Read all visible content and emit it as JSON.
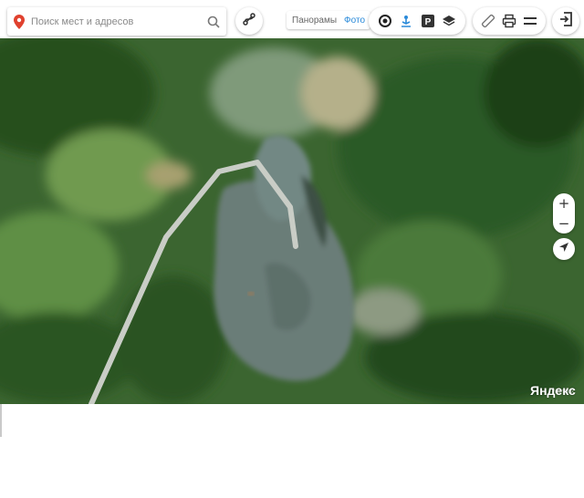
{
  "search": {
    "placeholder": "Поиск мест и адресов"
  },
  "panorama_toggle": {
    "panoramas_label": "Панорамы",
    "photo_label": "Фото"
  },
  "controls": {
    "zoom_in": "+",
    "zoom_out": "−",
    "route_icon": "route-icon",
    "traffic_icon": "traffic-icon",
    "transport_icon": "transport-icon",
    "parking_icon": "parking-icon",
    "layers_icon": "layers-icon",
    "ruler_icon": "ruler-icon",
    "print_icon": "print-icon",
    "menu_icon": "menu-icon",
    "login_icon": "login-icon",
    "geolocation_icon": "geolocation-icon"
  },
  "brand": {
    "logo_text": "Яндекс",
    "watermark": "Yandex"
  },
  "colors": {
    "accent_blue": "#2a8ad9",
    "pin_red": "#e0412e",
    "forest": "#2f5a27",
    "quarry": "#6a7d78"
  }
}
